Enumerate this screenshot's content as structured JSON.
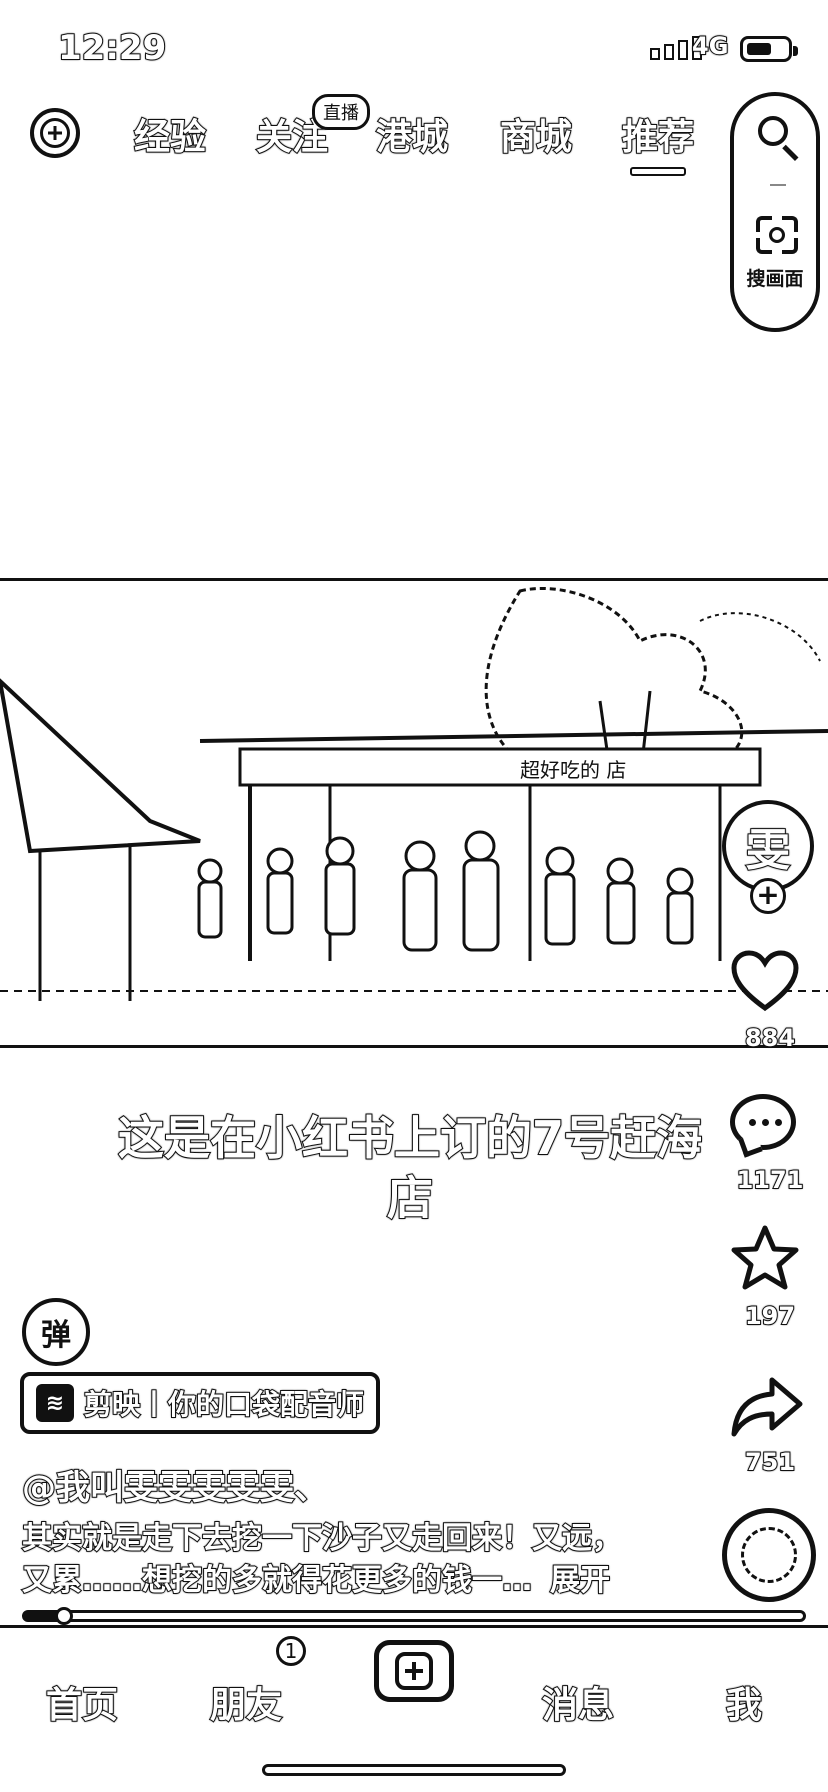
{
  "status_bar": {
    "time": "12:29",
    "network": "4G",
    "battery_level": 0.6
  },
  "top_nav": {
    "tabs": [
      {
        "label": "经验",
        "active": false
      },
      {
        "label": "关注",
        "active": false
      },
      {
        "label": "港城",
        "active": false
      },
      {
        "label": "商城",
        "active": false
      },
      {
        "label": "推荐",
        "active": true
      }
    ],
    "live_badge": "直播",
    "search_icon": "search-icon",
    "image_search_label": "搜画面"
  },
  "video": {
    "scene": "seaside-market-crowd",
    "shop_sign": "超好吃的 店"
  },
  "caption": "这是在小红书上订的7号赶海店",
  "actions": {
    "creator_avatar_text": "雯",
    "like_count": "884",
    "comment_count": "1171",
    "favorite_count": "197",
    "share_count": "751"
  },
  "danmaku_label": "弹",
  "capcut_tag": {
    "logo": "≋",
    "text": "剪映丨你的口袋配音师"
  },
  "author": "@我叫雯雯雯雯雯、",
  "description": {
    "text_line1": "其实就是走下去挖一下沙子又走回来！又远，",
    "text_line2": "又累……想挖的多就得花更多的钱一…",
    "expand_label": "展开"
  },
  "progress": {
    "value": 0.05
  },
  "tab_bar": {
    "home": "首页",
    "friends": "朋友",
    "friends_badge": "1",
    "messages": "消息",
    "me": "我"
  }
}
